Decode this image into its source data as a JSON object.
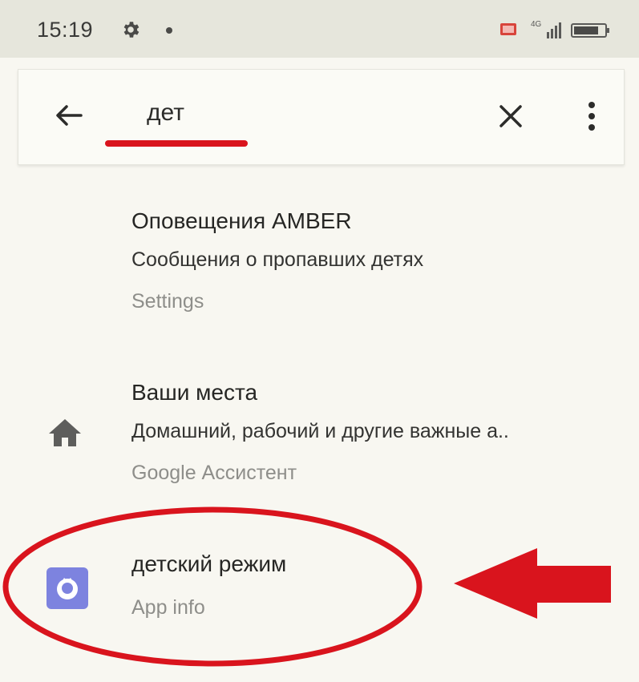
{
  "status_bar": {
    "time": "15:19",
    "network_label": "4G",
    "icons": [
      "gear-icon",
      "dot-icon",
      "cast-icon",
      "signal-icon",
      "battery-icon"
    ]
  },
  "search": {
    "query": "дет",
    "icons": [
      "back-arrow-icon",
      "close-icon",
      "more-vert-icon"
    ]
  },
  "results": [
    {
      "title": "Оповещения AMBER",
      "subtitle": "Сообщения о пропавших детях",
      "source": "Settings",
      "icon": ""
    },
    {
      "title": "Ваши места",
      "subtitle": "Домашний, рабочий и другие важные а..",
      "source": "Google Ассистент",
      "icon": "home-icon"
    },
    {
      "title": "детский режим",
      "subtitle": "",
      "source": "App info",
      "icon": "app-icon"
    }
  ],
  "colors": {
    "accent_red": "#d9141d",
    "app_icon": "#7d83df",
    "status_bar_bg": "#e6e6dc",
    "background": "#f8f7f1"
  }
}
